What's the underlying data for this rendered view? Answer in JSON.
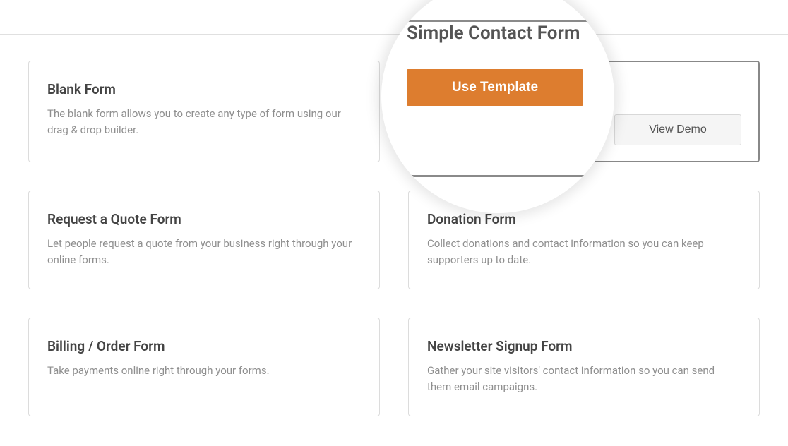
{
  "templates": [
    {
      "title": "Blank Form",
      "description": "The blank form allows you to create any type of form using our drag & drop builder."
    },
    {
      "title": "Simple Contact Form",
      "description": ""
    },
    {
      "title": "Request a Quote Form",
      "description": "Let people request a quote from your business right through your online forms."
    },
    {
      "title": "Donation Form",
      "description": "Collect donations and contact information so you can keep supporters up to date."
    },
    {
      "title": "Billing / Order Form",
      "description": "Take payments online right through your forms."
    },
    {
      "title": "Newsletter Signup Form",
      "description": "Gather your site visitors' contact information so you can send them email campaigns."
    }
  ],
  "magnifier": {
    "title": "Simple Contact Form",
    "use_template_label": "Use Template"
  },
  "buttons": {
    "view_demo": "View Demo"
  }
}
